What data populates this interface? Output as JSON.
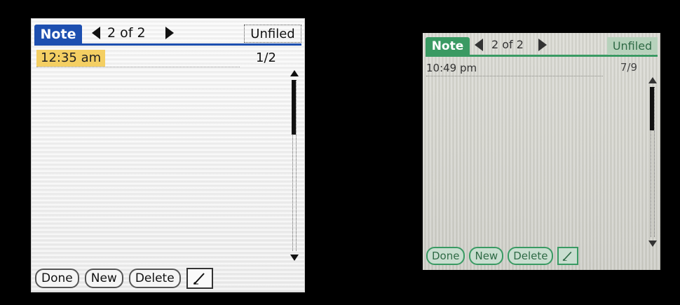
{
  "devices": [
    {
      "title": "Note",
      "page_counter": "2 of 2",
      "category": "Unfiled",
      "note_time": "12:35 am",
      "note_index": "1/2",
      "buttons": {
        "done": "Done",
        "new": "New",
        "delete": "Delete"
      },
      "accent_color": "#1d4fb0",
      "highlight_color": "#f4cf63"
    },
    {
      "title": "Note",
      "page_counter": "2 of 2",
      "category": "Unfiled",
      "note_time": "10:49 pm",
      "note_index": "7/9",
      "buttons": {
        "done": "Done",
        "new": "New",
        "delete": "Delete"
      },
      "accent_color": "#3a9a63"
    }
  ],
  "icons": {
    "prev": "arrow-left-icon",
    "next": "arrow-right-icon",
    "scroll_up": "scroll-up-icon",
    "scroll_down": "scroll-down-icon",
    "pen": "pen-icon"
  }
}
